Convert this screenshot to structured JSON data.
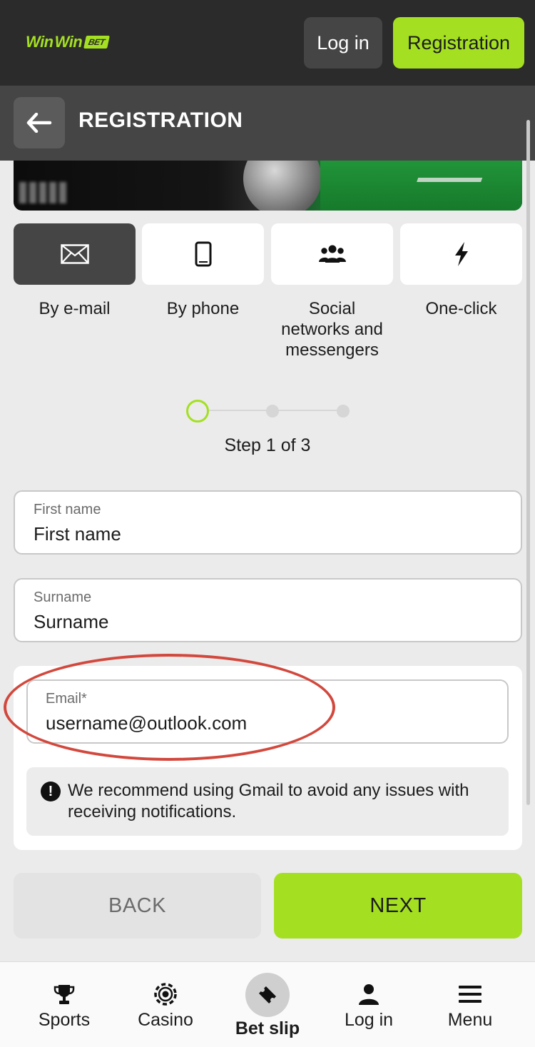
{
  "header": {
    "logo_part1": "Win",
    "logo_part2": "Win",
    "logo_badge": "BET",
    "login_label": "Log in",
    "registration_label": "Registration"
  },
  "title_bar": {
    "title": "REGISTRATION"
  },
  "methods": [
    {
      "label": "By e-mail",
      "icon": "envelope-icon",
      "active": true
    },
    {
      "label": "By phone",
      "icon": "phone-icon",
      "active": false
    },
    {
      "label": "Social networks and messengers",
      "icon": "group-icon",
      "active": false
    },
    {
      "label": "One-click",
      "icon": "lightning-icon",
      "active": false
    }
  ],
  "stepper": {
    "current": 1,
    "total": 3,
    "text": "Step 1 of 3"
  },
  "form": {
    "first_name": {
      "label": "First name",
      "value": "First name"
    },
    "surname": {
      "label": "Surname",
      "value": "Surname"
    },
    "email": {
      "label": "Email*",
      "value": "username@outlook.com"
    },
    "notice": "We recommend using Gmail to avoid any issues with receiving notifications."
  },
  "actions": {
    "back_label": "BACK",
    "next_label": "NEXT"
  },
  "bottom_nav": [
    {
      "label": "Sports",
      "icon": "trophy-icon"
    },
    {
      "label": "Casino",
      "icon": "casino-chip-icon"
    },
    {
      "label": "Bet slip",
      "icon": "ticket-icon"
    },
    {
      "label": "Log in",
      "icon": "user-icon"
    },
    {
      "label": "Menu",
      "icon": "hamburger-icon"
    }
  ],
  "colors": {
    "accent": "#a4e021",
    "header_bg": "#2b2b2b",
    "titlebar_bg": "#454545",
    "page_bg": "#ebebeb",
    "annotation": "#d2483d"
  }
}
